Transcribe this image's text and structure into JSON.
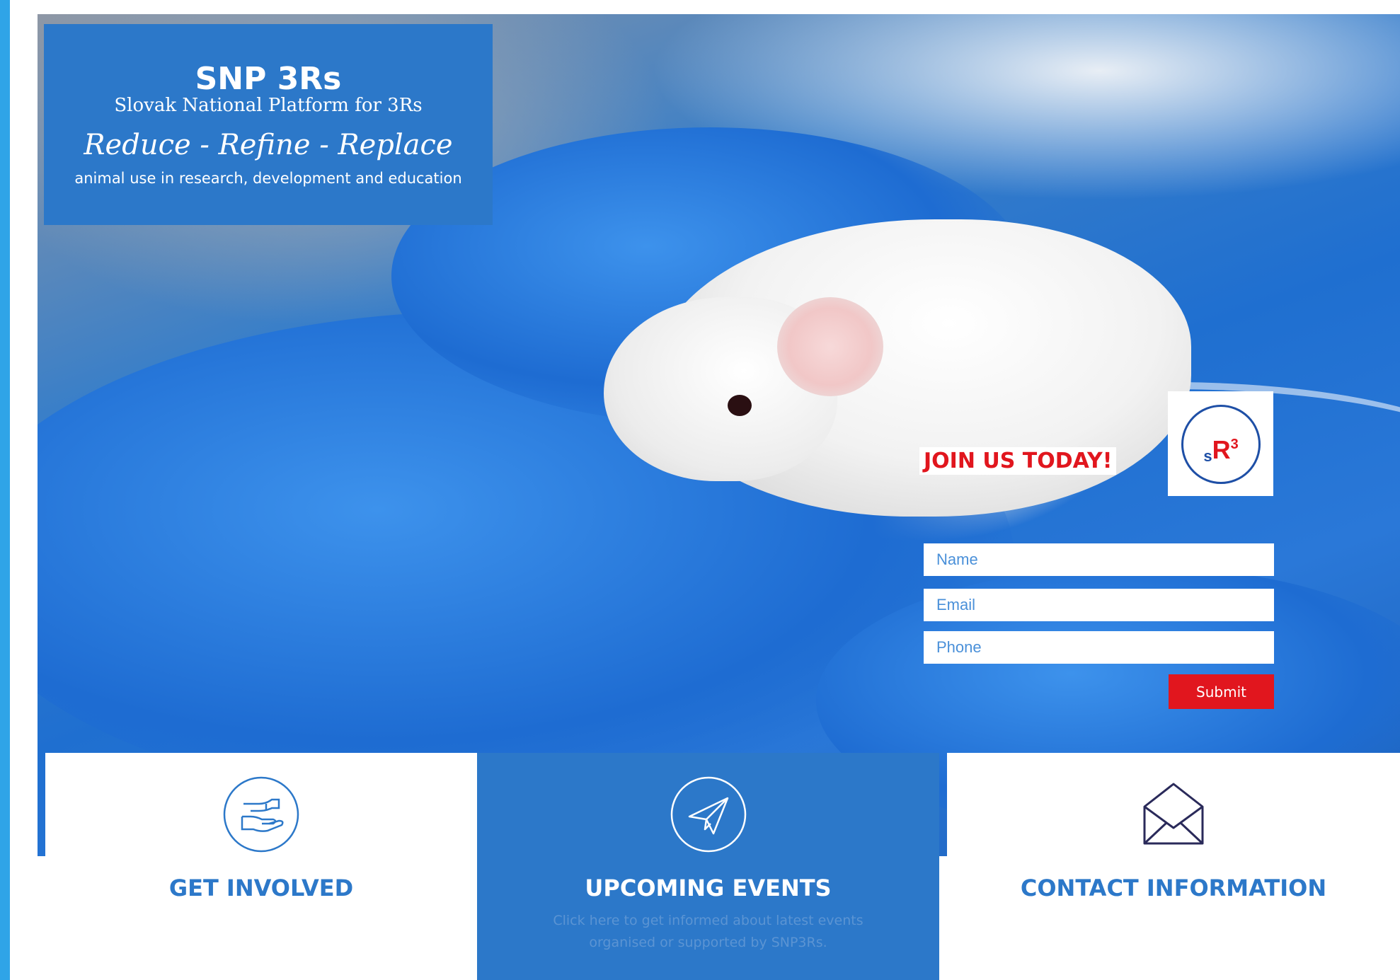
{
  "header": {
    "title": "SNP 3Rs",
    "subtitle": "Slovak National Platform for 3Rs",
    "tagline": "Reduce - Refine - Replace",
    "description": "animal use in research, development and education"
  },
  "signup": {
    "heading": "JOIN US TODAY!",
    "name_placeholder": "Name",
    "email_placeholder": "Email",
    "phone_placeholder": "Phone",
    "submit_label": "Submit"
  },
  "logo": {
    "s": "s",
    "r": "R",
    "sup": "3"
  },
  "cards": [
    {
      "title": "GET INVOLVED",
      "icon": "hand-helping-icon",
      "text": ""
    },
    {
      "title": "UPCOMING EVENTS",
      "icon": "paper-plane-icon",
      "text": "Click here to get informed about latest events organised or supported by SNP3Rs."
    },
    {
      "title": "CONTACT INFORMATION",
      "icon": "envelope-icon",
      "text": ""
    }
  ],
  "colors": {
    "brand_blue": "#2c78c9",
    "accent_red": "#e1161e",
    "side_strip": "#2fa4e7"
  }
}
